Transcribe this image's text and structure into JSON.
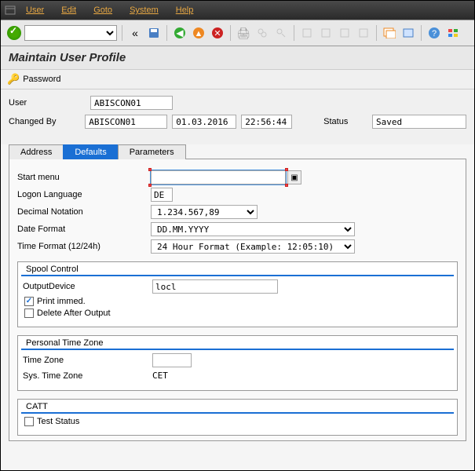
{
  "menubar": {
    "items": [
      "User",
      "Edit",
      "Goto",
      "System",
      "Help"
    ]
  },
  "page_title": "Maintain User Profile",
  "sub_toolbar": {
    "password_label": "Password"
  },
  "header": {
    "user_label": "User",
    "user_value": "ABISCON01",
    "changed_by_label": "Changed By",
    "changed_by_value": "ABISCON01",
    "changed_date": "01.03.2016",
    "changed_time": "22:56:44",
    "status_label": "Status",
    "status_value": "Saved"
  },
  "tabs": {
    "address": "Address",
    "defaults": "Defaults",
    "parameters": "Parameters"
  },
  "defaults": {
    "start_menu_label": "Start menu",
    "start_menu_value": "",
    "logon_language_label": "Logon Language",
    "logon_language_value": "DE",
    "decimal_notation_label": "Decimal Notation",
    "decimal_notation_value": "1.234.567,89",
    "date_format_label": "Date Format",
    "date_format_value": "DD.MM.YYYY",
    "time_format_label": "Time Format (12/24h)",
    "time_format_value": "24 Hour Format (Example: 12:05:10)"
  },
  "spool": {
    "title": "Spool Control",
    "output_device_label": "OutputDevice",
    "output_device_value": "locl",
    "print_immed_label": "Print immed.",
    "print_immed_checked": true,
    "delete_after_label": "Delete After Output",
    "delete_after_checked": false
  },
  "timezone": {
    "title": "Personal Time Zone",
    "time_zone_label": "Time Zone",
    "time_zone_value": "",
    "sys_time_zone_label": "Sys. Time Zone",
    "sys_time_zone_value": "CET"
  },
  "catt": {
    "title": "CATT",
    "test_status_label": "Test Status",
    "test_status_checked": false
  }
}
